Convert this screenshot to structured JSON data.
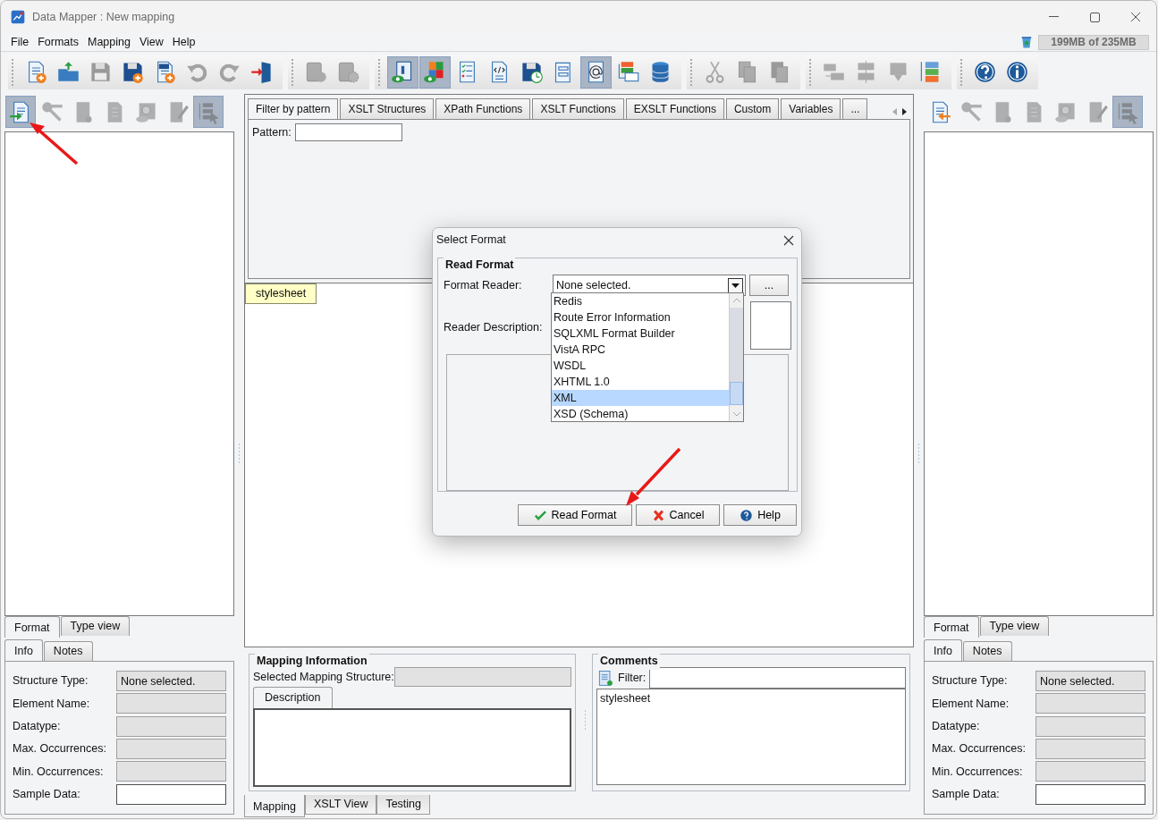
{
  "window": {
    "title": "Data Mapper : New mapping"
  },
  "menu": [
    {
      "label": "File"
    },
    {
      "label": "Formats"
    },
    {
      "label": "Mapping"
    },
    {
      "label": "View"
    },
    {
      "label": "Help"
    }
  ],
  "memory": "199MB of 235MB",
  "toolbar": {
    "groups": [
      [
        {
          "selected": false,
          "disabled": false
        },
        {
          "selected": false,
          "disabled": false
        },
        {
          "selected": false,
          "disabled": true
        },
        {
          "selected": false,
          "disabled": false
        },
        {
          "selected": false,
          "disabled": false
        },
        {
          "selected": false,
          "disabled": true
        },
        {
          "selected": false,
          "disabled": true
        },
        {
          "selected": false,
          "disabled": false
        }
      ],
      [
        {
          "selected": false,
          "disabled": true
        },
        {
          "selected": false,
          "disabled": true
        }
      ],
      [
        {
          "selected": true,
          "disabled": false
        },
        {
          "selected": true,
          "disabled": false
        },
        {
          "selected": false,
          "disabled": false
        },
        {
          "selected": false,
          "disabled": false
        },
        {
          "selected": false,
          "disabled": false
        },
        {
          "selected": false,
          "disabled": false
        },
        {
          "selected": true,
          "disabled": false
        },
        {
          "selected": false,
          "disabled": false
        },
        {
          "selected": false,
          "disabled": false
        }
      ],
      [
        {
          "selected": false,
          "disabled": true
        },
        {
          "selected": false,
          "disabled": true
        },
        {
          "selected": false,
          "disabled": true
        }
      ],
      [
        {
          "selected": false,
          "disabled": true
        },
        {
          "selected": false,
          "disabled": true
        },
        {
          "selected": false,
          "disabled": true
        },
        {
          "selected": false,
          "disabled": false
        }
      ],
      [
        {
          "selected": false,
          "disabled": false
        },
        {
          "selected": false,
          "disabled": false
        }
      ]
    ]
  },
  "source_panel": {
    "tools": [
      {
        "selected": true,
        "disabled": false
      },
      {
        "selected": false,
        "disabled": true
      },
      {
        "selected": false,
        "disabled": true
      },
      {
        "selected": false,
        "disabled": true
      },
      {
        "selected": false,
        "disabled": true
      },
      {
        "selected": false,
        "disabled": true
      },
      {
        "selected": true,
        "disabled": true
      }
    ],
    "view_tabs": [
      {
        "label": "Format",
        "selected": true
      },
      {
        "label": "Type view",
        "selected": false
      }
    ],
    "info_tabs": [
      {
        "label": "Info",
        "selected": true
      },
      {
        "label": "Notes",
        "selected": false
      }
    ],
    "fields": [
      {
        "label": "Structure Type:",
        "value": "None selected.",
        "disabled": true
      },
      {
        "label": "Element Name:",
        "disabled": true
      },
      {
        "label": "Datatype:",
        "disabled": true
      },
      {
        "label": "Max. Occurrences:",
        "disabled": true
      },
      {
        "label": "Min. Occurrences:",
        "disabled": true
      },
      {
        "label": "Sample Data:",
        "disabled": false
      }
    ]
  },
  "target_panel": {
    "tools": [
      {
        "selected": false,
        "disabled": false
      },
      {
        "selected": false,
        "disabled": true
      },
      {
        "selected": false,
        "disabled": true
      },
      {
        "selected": false,
        "disabled": true
      },
      {
        "selected": false,
        "disabled": true
      },
      {
        "selected": false,
        "disabled": true
      },
      {
        "selected": true,
        "disabled": true
      }
    ],
    "view_tabs": [
      {
        "label": "Format",
        "selected": true
      },
      {
        "label": "Type view",
        "selected": false
      }
    ],
    "info_tabs": [
      {
        "label": "Info",
        "selected": true
      },
      {
        "label": "Notes",
        "selected": false
      }
    ],
    "fields": [
      {
        "label": "Structure Type:",
        "value": "None selected.",
        "disabled": true
      },
      {
        "label": "Element Name:",
        "disabled": true
      },
      {
        "label": "Datatype:",
        "disabled": true
      },
      {
        "label": "Max. Occurrences:",
        "disabled": true
      },
      {
        "label": "Min. Occurrences:",
        "disabled": true
      },
      {
        "label": "Sample Data:",
        "disabled": false
      }
    ]
  },
  "function_tabs": [
    {
      "label": "Filter by pattern",
      "selected": true
    },
    {
      "label": "XSLT Structures",
      "selected": false
    },
    {
      "label": "XPath Functions",
      "selected": false
    },
    {
      "label": "XSLT Functions",
      "selected": false
    },
    {
      "label": "EXSLT Functions",
      "selected": false
    },
    {
      "label": "Custom",
      "selected": false
    },
    {
      "label": "Variables",
      "selected": false
    },
    {
      "label": "...",
      "selected": false
    }
  ],
  "pattern": {
    "label": "Pattern:"
  },
  "mapping_canvas": {
    "nodes": [
      {
        "label": "stylesheet"
      }
    ]
  },
  "mapping_information": {
    "title": "Mapping Information",
    "structure_label": "Selected Mapping Structure:",
    "tabs": [
      {
        "label": "Description",
        "selected": true
      }
    ]
  },
  "comments": {
    "title": "Comments",
    "filter_label": "Filter:",
    "items": [
      "stylesheet"
    ]
  },
  "bottom_tabs": [
    {
      "label": "Mapping",
      "selected": true
    },
    {
      "label": "XSLT View",
      "selected": false
    },
    {
      "label": "Testing",
      "selected": false
    }
  ],
  "dialog": {
    "title": "Select Format",
    "group": "Read Format",
    "reader_label": "Format Reader:",
    "reader_value": "None selected.",
    "browse": "...",
    "description_label": "Reader Description:",
    "options": [
      {
        "label": "Redis",
        "selected": false
      },
      {
        "label": "Route Error Information",
        "selected": false
      },
      {
        "label": "SQLXML Format Builder",
        "selected": false
      },
      {
        "label": "VistA RPC",
        "selected": false
      },
      {
        "label": "WSDL",
        "selected": false
      },
      {
        "label": "XHTML 1.0",
        "selected": false
      },
      {
        "label": "XML",
        "selected": true
      },
      {
        "label": "XSD (Schema)",
        "selected": false
      }
    ],
    "buttons": [
      {
        "kind": "ok",
        "label": "Read Format"
      },
      {
        "kind": "cancel",
        "label": "Cancel"
      },
      {
        "kind": "help",
        "label": "Help"
      }
    ]
  }
}
